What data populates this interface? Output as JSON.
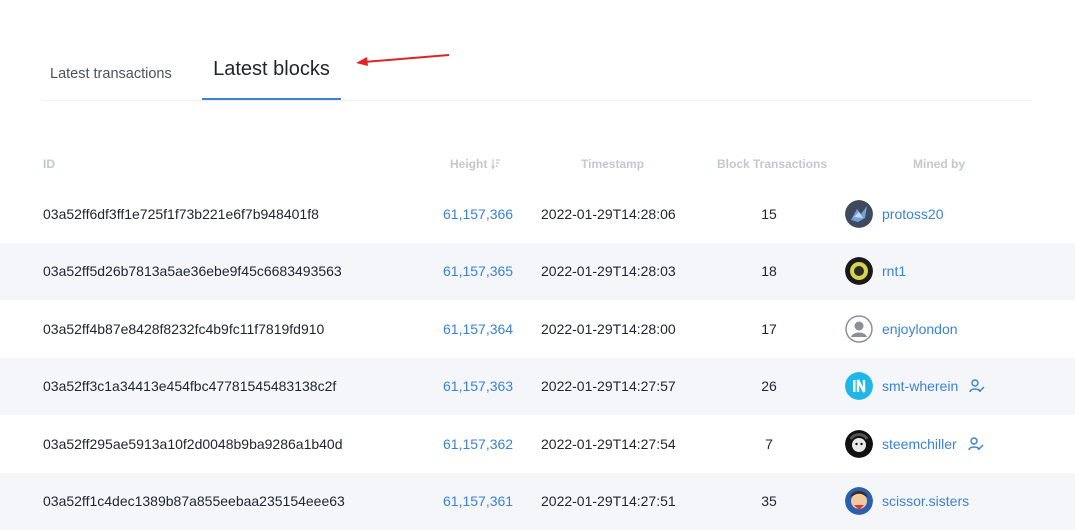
{
  "tabs": [
    {
      "label": "Latest transactions",
      "active": false
    },
    {
      "label": "Latest blocks",
      "active": true
    }
  ],
  "table": {
    "columns": [
      "ID",
      "Height",
      "Timestamp",
      "Block Transactions",
      "Mined by"
    ],
    "rows": [
      {
        "id": "03a52ff6df3ff1e725f1f73b221e6f7b948401f8",
        "height": "61,157,366",
        "timestamp": "2022-01-29T14:28:06",
        "tx": "15",
        "miner": "protoss20"
      },
      {
        "id": "03a52ff5d26b7813a5ae36ebe9f45c6683493563",
        "height": "61,157,365",
        "timestamp": "2022-01-29T14:28:03",
        "tx": "18",
        "miner": "rnt1"
      },
      {
        "id": "03a52ff4b87e8428f8232fc4b9fc11f7819fd910",
        "height": "61,157,364",
        "timestamp": "2022-01-29T14:28:00",
        "tx": "17",
        "miner": "enjoylondon"
      },
      {
        "id": "03a52ff3c1a34413e454fbc47781545483138c2f",
        "height": "61,157,363",
        "timestamp": "2022-01-29T14:27:57",
        "tx": "26",
        "miner": "smt-wherein"
      },
      {
        "id": "03a52ff295ae5913a10f2d0048b9ba9286a1b40d",
        "height": "61,157,362",
        "timestamp": "2022-01-29T14:27:54",
        "tx": "7",
        "miner": "steemchiller"
      },
      {
        "id": "03a52ff1c4dec1389b87a855eebaa235154eee63",
        "height": "61,157,361",
        "timestamp": "2022-01-29T14:27:51",
        "tx": "35",
        "miner": "scissor.sisters"
      }
    ]
  },
  "colors": {
    "accent": "#3b82d6",
    "annotation_arrow": "#e02424",
    "row_alt": "#f4f6fa"
  }
}
